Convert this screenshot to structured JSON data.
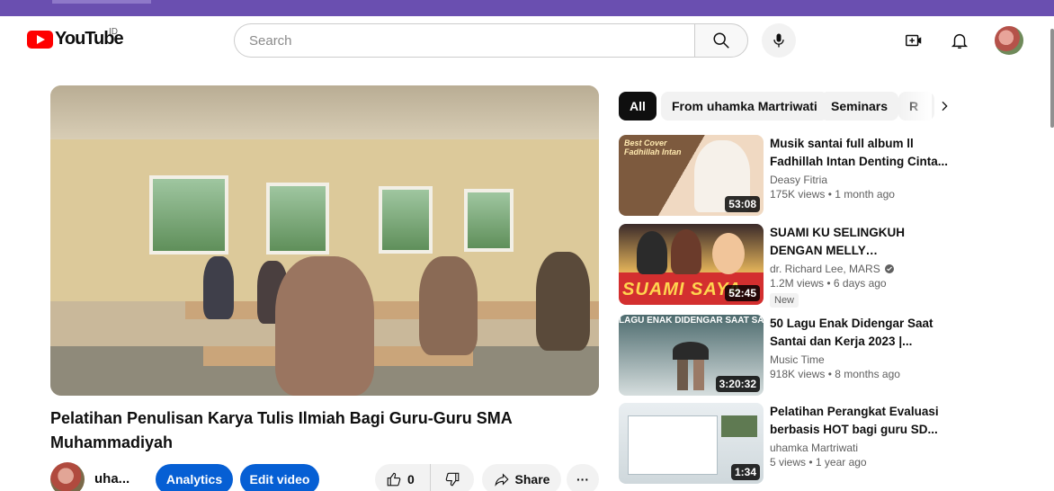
{
  "brand": {
    "logo_text": "YouTube",
    "region": "ID",
    "accent": "#ff0000"
  },
  "search": {
    "placeholder": "Search"
  },
  "video": {
    "title": "Pelatihan Penulisan Karya Tulis Ilmiah Bagi Guru-Guru SMA Muhammadiyah",
    "owner_name": "uha...",
    "analytics_label": "Analytics",
    "edit_label": "Edit video",
    "like_count": "0",
    "share_label": "Share",
    "more_label": "···"
  },
  "chips": [
    {
      "label": "All",
      "active": true
    },
    {
      "label": "From uhamka Martriwati"
    },
    {
      "label": "Seminars"
    },
    {
      "label": "R"
    }
  ],
  "recommendations": [
    {
      "title": "Musik santai full album ll Fadhillah Intan Denting Cinta...",
      "channel": "Deasy Fitria",
      "stats": "175K views • 1 month ago",
      "duration": "53:08",
      "thumb_text": "Best Cover Fadhillah Intan"
    },
    {
      "title": "SUAMI KU SELINGKUH DENGAN MELLY GOESLOW??...",
      "channel": "dr. Richard Lee, MARS",
      "verified": true,
      "stats": "1.2M views • 6 days ago",
      "badge": "New",
      "duration": "52:45",
      "thumb_text": "SUAMI SAYA"
    },
    {
      "title": "50 Lagu Enak Didengar Saat Santai dan Kerja 2023 |...",
      "channel": "Music Time",
      "stats": "918K views • 8 months ago",
      "duration": "3:20:32",
      "thumb_text": "LAGU ENAK DIDENGAR SAAT SANTAI"
    },
    {
      "title": "Pelatihan Perangkat Evaluasi berbasis HOT bagi guru SD...",
      "channel": "uhamka Martriwati",
      "stats": "5 views • 1 year ago",
      "duration": "1:34"
    }
  ]
}
